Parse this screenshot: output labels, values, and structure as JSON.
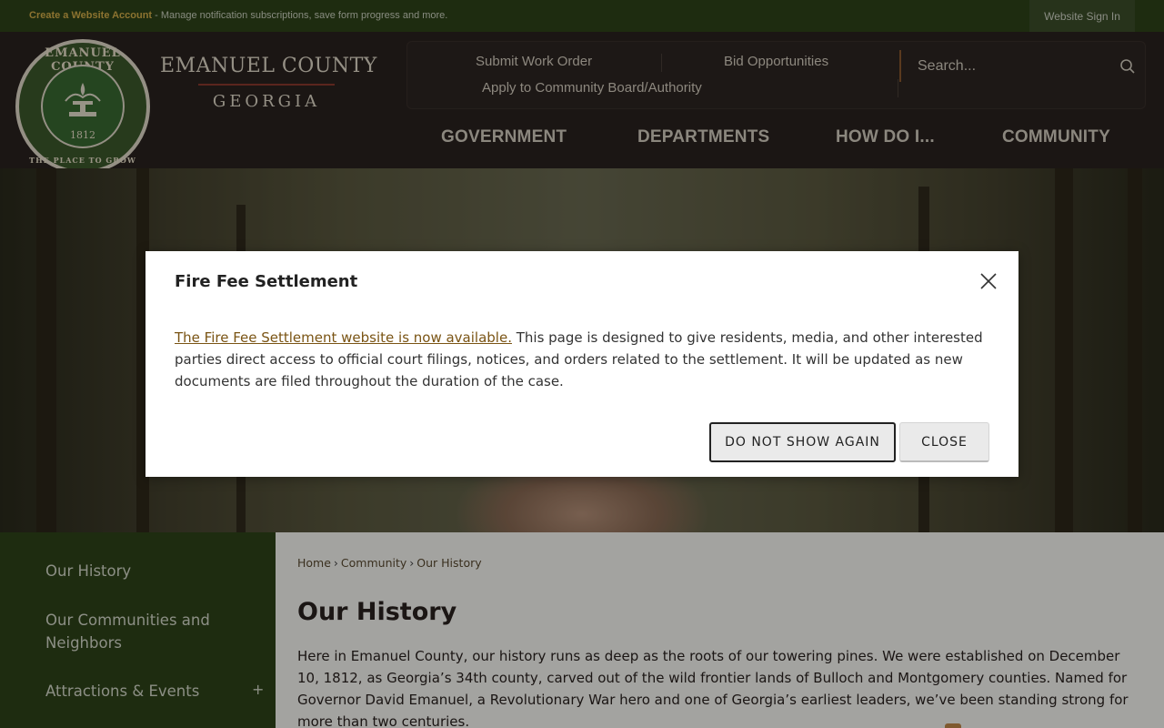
{
  "topbar": {
    "create_account": "Create a Website Account",
    "message": " - Manage notification subscriptions, save form progress and more.",
    "signin": "Website Sign In"
  },
  "header": {
    "seal_top": "EMANUEL COUNTY",
    "seal_year": "1812",
    "seal_bottom": "THE PLACE TO GROW",
    "brand_name": "EMANUEL COUNTY",
    "brand_state": "GEORGIA",
    "quicklinks": [
      "Submit Work Order",
      "Bid Opportunities",
      "Apply to Community Board/Authority"
    ],
    "search_placeholder": "Search...",
    "nav": [
      "GOVERNMENT",
      "DEPARTMENTS",
      "HOW DO I...",
      "COMMUNITY"
    ]
  },
  "sidebar": {
    "items": [
      "Our History",
      "Our Communities and Neighbors",
      "Attractions & Events"
    ],
    "expand_symbol": "+"
  },
  "main": {
    "breadcrumb": [
      "Home",
      "Community",
      "Our History"
    ],
    "breadcrumb_sep": "›",
    "title": "Our History",
    "intro": "Here in Emanuel County, our history runs as deep as the roots of our towering pines. We were established on December 10, 1812, as Georgia’s 34th county, carved out of the wild frontier lands of Bulloch and Montgomery counties. Named for Governor David Emanuel, a Revolutionary War hero and one of Georgia’s earliest leaders, we’ve been standing strong for more than two centuries."
  },
  "modal": {
    "title": "Fire Fee Settlement",
    "link_text": "The Fire Fee Settlement website is now available.",
    "body_text": " This page is designed to give residents, media, and other interested parties direct access to official court filings, notices, and orders related to the settlement. It will be updated as new documents are filed throughout the duration of the case.",
    "do_not_show": "DO NOT SHOW AGAIN",
    "close": "CLOSE"
  },
  "colors": {
    "topbar_green": "#2f4419",
    "header_dark": "#2a2220",
    "accent_gold": "#d8b14a",
    "link_brown": "#7a5414"
  }
}
